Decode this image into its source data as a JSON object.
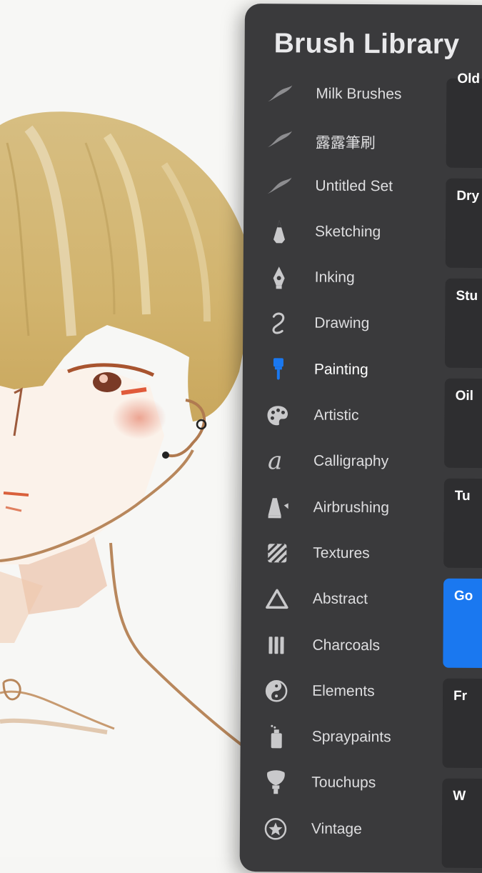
{
  "panel": {
    "title": "Brush Library"
  },
  "brush_sets": [
    {
      "label": "Milk Brushes",
      "icon": "brush-stroke-icon"
    },
    {
      "label": "露露筆刷",
      "icon": "brush-stroke-icon"
    },
    {
      "label": "Untitled Set",
      "icon": "brush-stroke-icon"
    },
    {
      "label": "Sketching",
      "icon": "pencil-icon"
    },
    {
      "label": "Inking",
      "icon": "pen-nib-icon"
    },
    {
      "label": "Drawing",
      "icon": "squiggle-icon"
    },
    {
      "label": "Painting",
      "icon": "paint-brush-icon",
      "active": true
    },
    {
      "label": "Artistic",
      "icon": "palette-icon"
    },
    {
      "label": "Calligraphy",
      "icon": "calligraphy-a-icon"
    },
    {
      "label": "Airbrushing",
      "icon": "airbrush-icon"
    },
    {
      "label": "Textures",
      "icon": "texture-icon"
    },
    {
      "label": "Abstract",
      "icon": "triangle-icon"
    },
    {
      "label": "Charcoals",
      "icon": "charcoal-icon"
    },
    {
      "label": "Elements",
      "icon": "yin-yang-icon"
    },
    {
      "label": "Spraypaints",
      "icon": "spray-can-icon"
    },
    {
      "label": "Touchups",
      "icon": "touchup-brush-icon"
    },
    {
      "label": "Vintage",
      "icon": "star-badge-icon"
    }
  ],
  "brushes": [
    {
      "name": "Old"
    },
    {
      "name": "Dry"
    },
    {
      "name": "Stu"
    },
    {
      "name": "Oil"
    },
    {
      "name": "Tu"
    },
    {
      "name": "Go",
      "selected": true
    },
    {
      "name": "Fr"
    },
    {
      "name": "W"
    }
  ],
  "colors": {
    "accent": "#1a78f0",
    "panel": "#3a3a3c",
    "card": "#2e2e30"
  }
}
